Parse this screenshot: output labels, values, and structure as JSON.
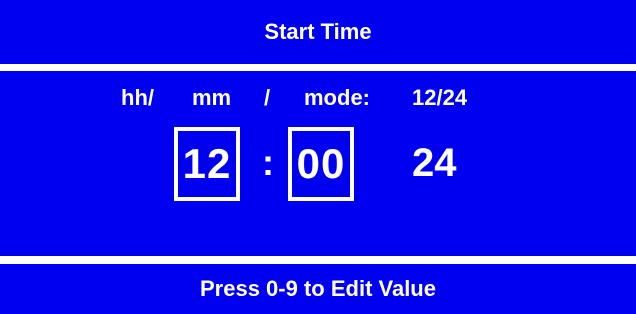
{
  "header": {
    "title": "Start Time"
  },
  "labels": {
    "hour": "hh/",
    "minute": "mm",
    "separator": "/",
    "mode": "mode:",
    "mode_options": "12/24"
  },
  "fields": {
    "hour": "12",
    "colon": ":",
    "minute": "00",
    "mode": "24"
  },
  "footer": {
    "hint": "Press 0-9 to Edit Value"
  },
  "colors": {
    "panel_background": "#0000f0",
    "text": "#ffffff",
    "divider": "#ffffff"
  }
}
